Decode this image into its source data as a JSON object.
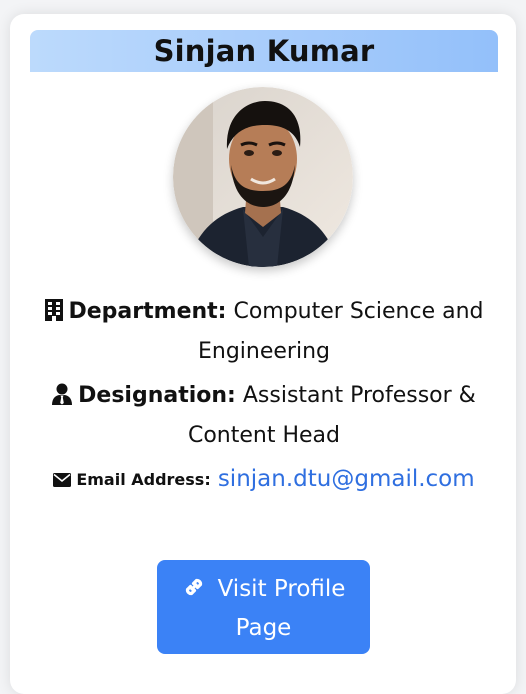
{
  "profile": {
    "name": "Sinjan Kumar",
    "department_label": "Department:",
    "department_value": "Computer Science and Engineering",
    "designation_label": "Designation:",
    "designation_value": "Assistant Professor & Content Head",
    "email_label": "Email Address:",
    "email_value": "sinjan.dtu@gmail.com",
    "button_label": "Visit Profile Page"
  },
  "icons": {
    "department": "building-icon",
    "designation": "user-tie-icon",
    "email": "envelope-icon",
    "button": "link-icon"
  },
  "colors": {
    "banner_gradient_start": "#bcdafc",
    "banner_gradient_end": "#93c0fa",
    "email_link": "#2f6fe0",
    "button_background": "#3b82f6",
    "button_text": "#ffffff"
  }
}
